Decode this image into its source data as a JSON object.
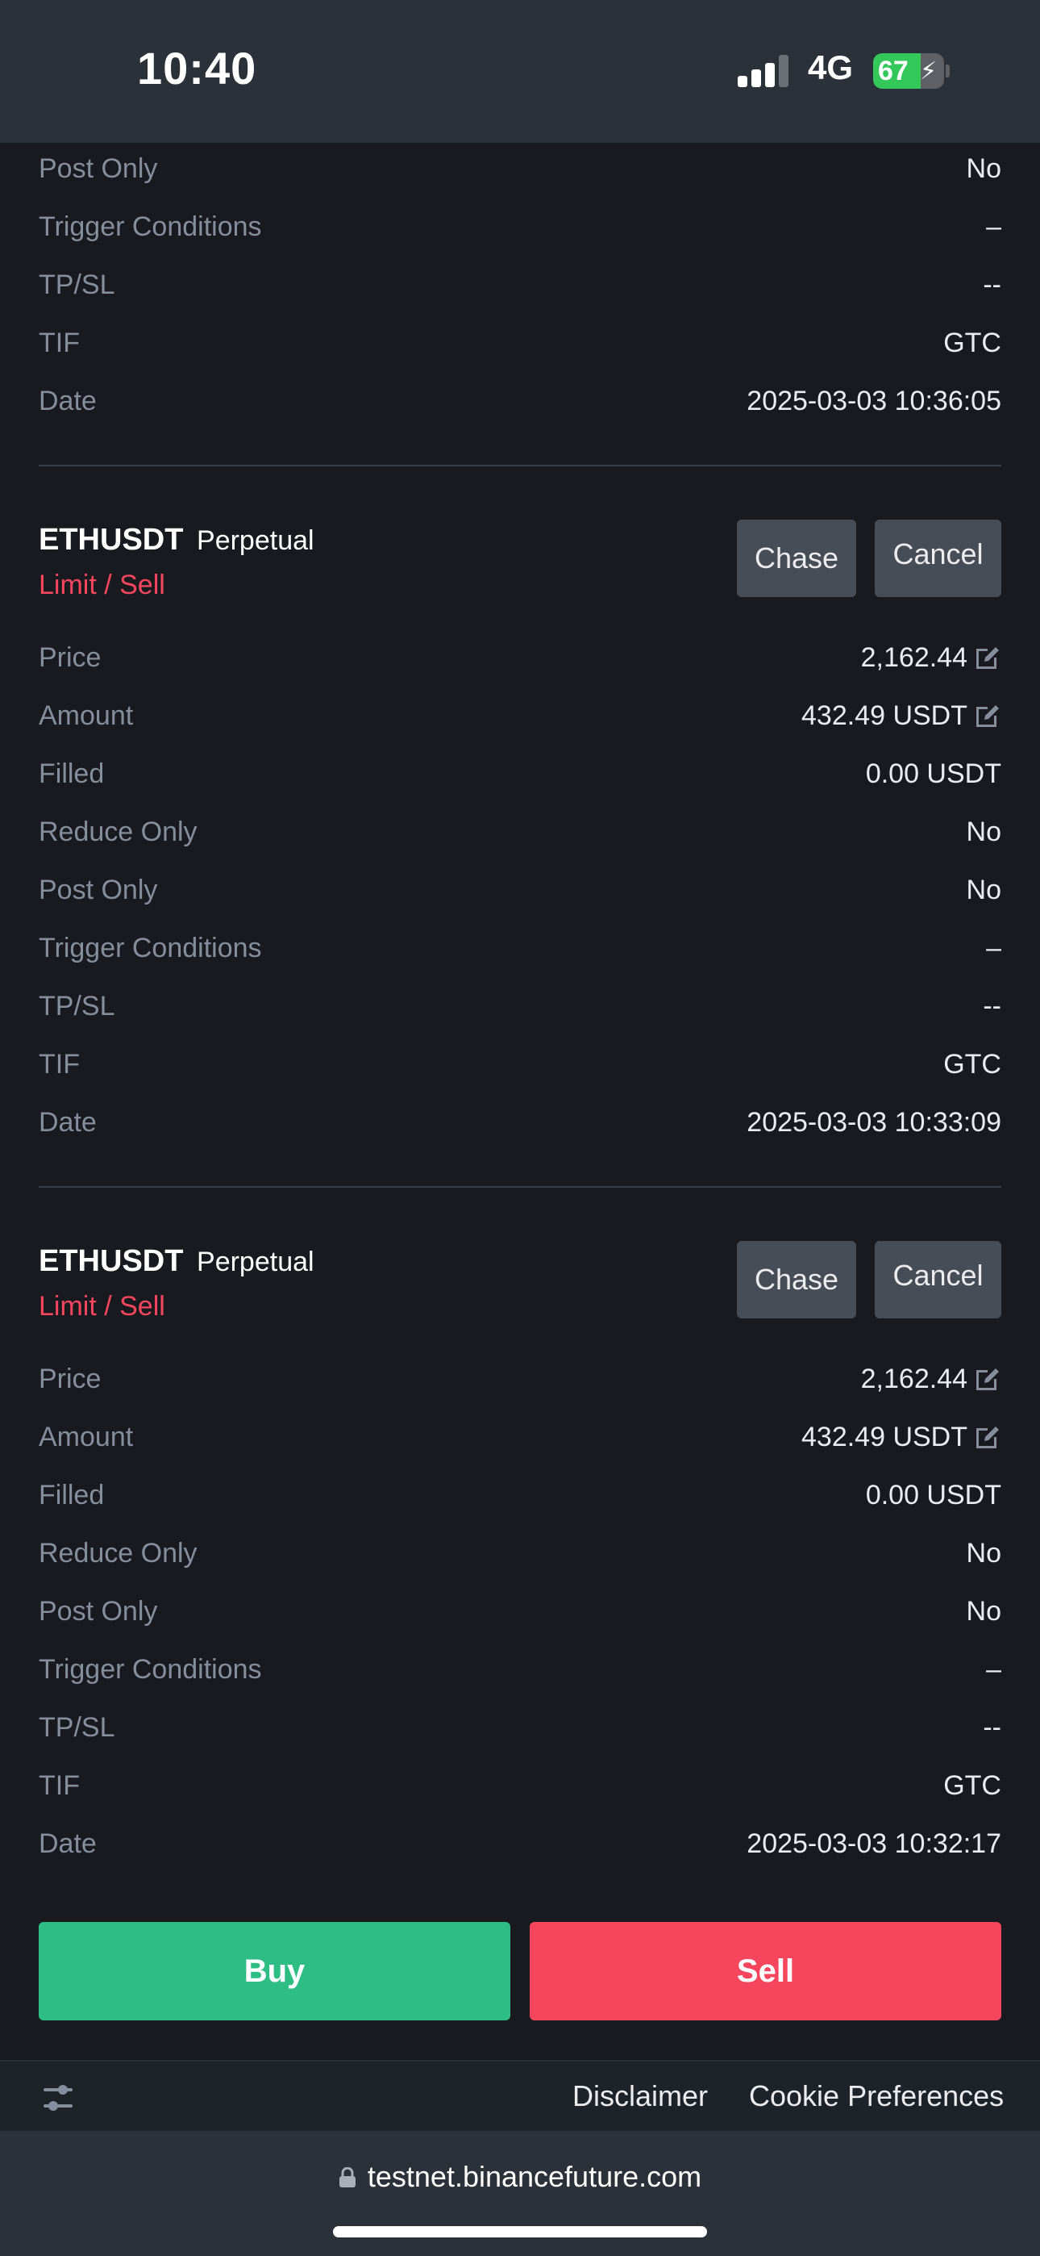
{
  "status_bar": {
    "time": "10:40",
    "network": "4G",
    "battery": "67",
    "battery_level": 0.67
  },
  "top_order": {
    "rows": [
      {
        "label": "Post Only",
        "value": "No"
      },
      {
        "label": "Trigger Conditions",
        "value": "–"
      },
      {
        "label": "TP/SL",
        "value": "--"
      },
      {
        "label": "TIF",
        "value": "GTC"
      },
      {
        "label": "Date",
        "value": "2025-03-03 10:36:05"
      }
    ]
  },
  "orders": [
    {
      "symbol": "ETHUSDT",
      "contract_type": "Perpetual",
      "side": "Limit / Sell",
      "chase_label": "Chase",
      "cancel_label": "Cancel",
      "rows": [
        {
          "label": "Price",
          "value": "2,162.44"
        },
        {
          "label": "Amount",
          "value": "432.49 USDT"
        },
        {
          "label": "Filled",
          "value": "0.00 USDT"
        },
        {
          "label": "Reduce Only",
          "value": "No"
        },
        {
          "label": "Post Only",
          "value": "No"
        },
        {
          "label": "Trigger Conditions",
          "value": "–"
        },
        {
          "label": "TP/SL",
          "value": "--"
        },
        {
          "label": "TIF",
          "value": "GTC"
        },
        {
          "label": "Date",
          "value": "2025-03-03 10:33:09"
        }
      ]
    },
    {
      "symbol": "ETHUSDT",
      "contract_type": "Perpetual",
      "side": "Limit / Sell",
      "chase_label": "Chase",
      "cancel_label": "Cancel",
      "rows": [
        {
          "label": "Price",
          "value": "2,162.44"
        },
        {
          "label": "Amount",
          "value": "432.49 USDT"
        },
        {
          "label": "Filled",
          "value": "0.00 USDT"
        },
        {
          "label": "Reduce Only",
          "value": "No"
        },
        {
          "label": "Post Only",
          "value": "No"
        },
        {
          "label": "Trigger Conditions",
          "value": "–"
        },
        {
          "label": "TP/SL",
          "value": "--"
        },
        {
          "label": "TIF",
          "value": "GTC"
        },
        {
          "label": "Date",
          "value": "2025-03-03 10:32:17"
        }
      ]
    }
  ],
  "actions": {
    "buy_label": "Buy",
    "sell_label": "Sell"
  },
  "footer": {
    "disclaimer": "Disclaimer",
    "cookie_preferences": "Cookie Preferences"
  },
  "browser": {
    "url": "testnet.binancefuture.com"
  },
  "colors": {
    "background": "#181a20",
    "buy": "#2ebd85",
    "sell": "#f6465d",
    "label": "#848e9c",
    "button": "#474d57"
  }
}
